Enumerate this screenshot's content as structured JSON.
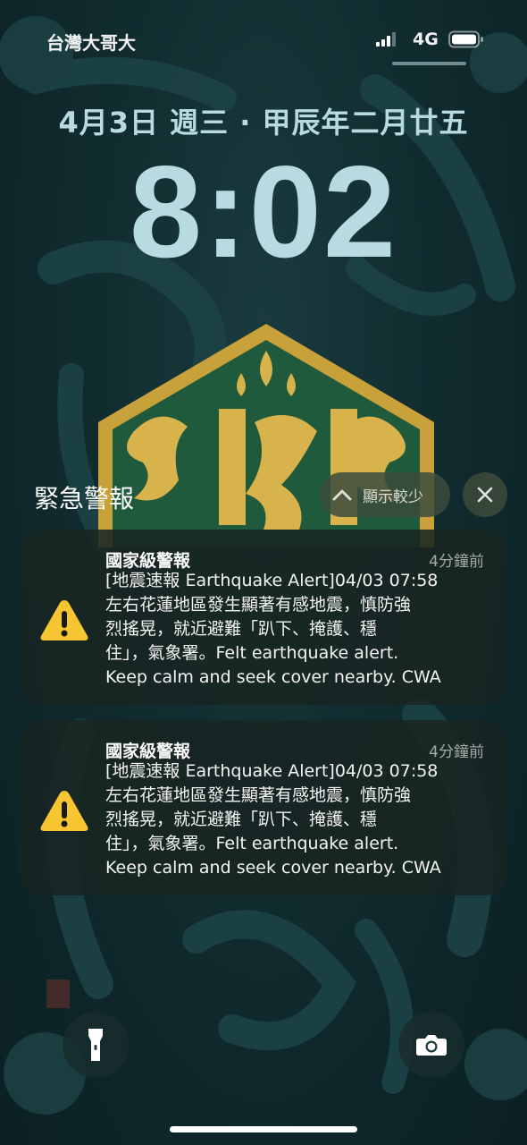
{
  "status_bar": {
    "carrier": "台灣大哥大",
    "network": "4G",
    "icons": [
      "signal-icon",
      "battery-icon"
    ]
  },
  "lock_screen": {
    "date": "4月3日 週三 · 甲辰年二月廿五",
    "time": "8:02"
  },
  "notifications": {
    "group_title": "緊急警報",
    "show_less_label": "顯示較少",
    "items": [
      {
        "title": "國家級警報",
        "time": "4分鐘前",
        "icon": "warning-icon",
        "lines": [
          "[地震速報 Earthquake Alert]04/03 07:58",
          "左右花蓮地區發生顯著有感地震，慎防強",
          "烈搖晃，就近避難「趴下、掩護、穩",
          "住」，氣象署。Felt earthquake alert.",
          "Keep calm and seek cover nearby. CWA"
        ]
      },
      {
        "title": "國家級警報",
        "time": "4分鐘前",
        "icon": "warning-icon",
        "lines": [
          "[地震速報 Earthquake Alert]04/03 07:58",
          "左右花蓮地區發生顯著有感地震，慎防強",
          "烈搖晃，就近避難「趴下、掩護、穩",
          "住」，氣象署。Felt earthquake alert.",
          "Keep calm and seek cover nearby. CWA"
        ]
      }
    ]
  },
  "quick_actions": [
    "flashlight-icon",
    "camera-icon"
  ],
  "colors": {
    "background": "#112c2f",
    "clock": "#b8dbe2",
    "emblem_gold": "#c9a13a",
    "emblem_green": "#1f5a3c",
    "warning_yellow": "#f7c531"
  }
}
